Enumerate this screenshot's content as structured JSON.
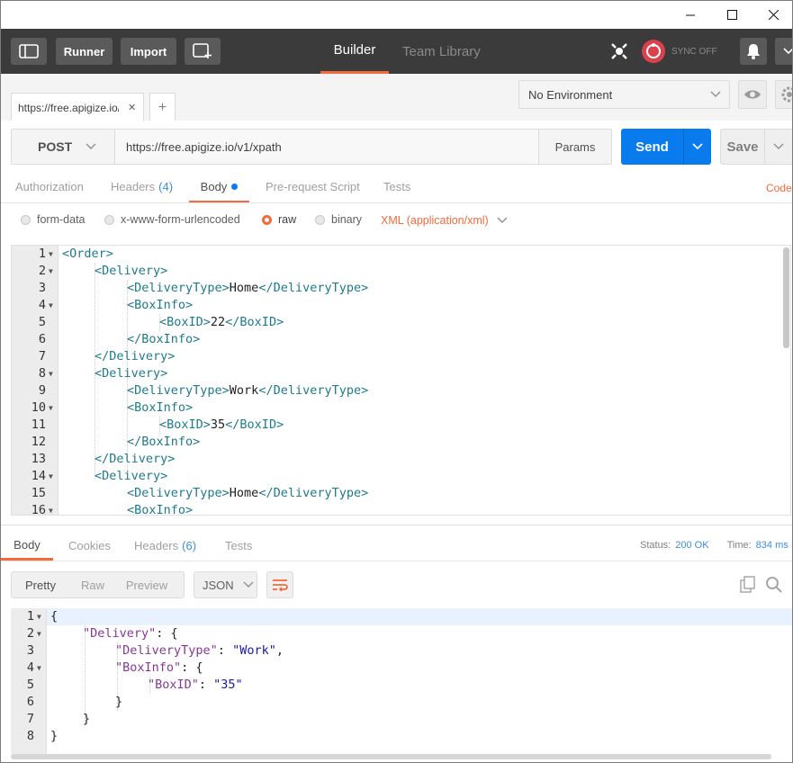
{
  "header": {
    "runner": "Runner",
    "import": "Import",
    "builder": "Builder",
    "team_library": "Team Library",
    "sync": "SYNC OFF"
  },
  "request_tab": {
    "label": "https://free.apigize.io/",
    "close": "✕",
    "add": "+"
  },
  "environment": {
    "label": "No Environment"
  },
  "request": {
    "method": "POST",
    "url": "https://free.apigize.io/v1/xpath",
    "params": "Params",
    "send": "Send",
    "save": "Save"
  },
  "request_tabs": {
    "authorization": "Authorization",
    "headers": "Headers",
    "headers_count": "(4)",
    "body": "Body",
    "prerequest": "Pre-request Script",
    "tests": "Tests",
    "code": "Code"
  },
  "body_modes": {
    "form_data": "form-data",
    "urlencoded": "x-www-form-urlencoded",
    "raw": "raw",
    "binary": "binary",
    "content_type": "XML (application/xml)"
  },
  "request_body_lines": [
    {
      "n": "1",
      "fold": true,
      "ind": 0,
      "parts": [
        [
          "tag",
          "<Order>"
        ]
      ]
    },
    {
      "n": "2",
      "fold": true,
      "ind": 1,
      "parts": [
        [
          "tag",
          "<Delivery>"
        ]
      ]
    },
    {
      "n": "3",
      "fold": false,
      "ind": 2,
      "parts": [
        [
          "tag",
          "<DeliveryType>"
        ],
        [
          "txt",
          "Home"
        ],
        [
          "tag",
          "</DeliveryType>"
        ]
      ]
    },
    {
      "n": "4",
      "fold": true,
      "ind": 2,
      "parts": [
        [
          "tag",
          "<BoxInfo>"
        ]
      ]
    },
    {
      "n": "5",
      "fold": false,
      "ind": 3,
      "parts": [
        [
          "tag",
          "<BoxID>"
        ],
        [
          "txt",
          "22"
        ],
        [
          "tag",
          "</BoxID>"
        ]
      ]
    },
    {
      "n": "6",
      "fold": false,
      "ind": 2,
      "parts": [
        [
          "tag",
          "</BoxInfo>"
        ]
      ]
    },
    {
      "n": "7",
      "fold": false,
      "ind": 1,
      "parts": [
        [
          "tag",
          "</Delivery>"
        ]
      ]
    },
    {
      "n": "8",
      "fold": true,
      "ind": 1,
      "parts": [
        [
          "tag",
          "<Delivery>"
        ]
      ]
    },
    {
      "n": "9",
      "fold": false,
      "ind": 2,
      "parts": [
        [
          "tag",
          "<DeliveryType>"
        ],
        [
          "txt",
          "Work"
        ],
        [
          "tag",
          "</DeliveryType>"
        ]
      ]
    },
    {
      "n": "10",
      "fold": true,
      "ind": 2,
      "parts": [
        [
          "tag",
          "<BoxInfo>"
        ]
      ]
    },
    {
      "n": "11",
      "fold": false,
      "ind": 3,
      "parts": [
        [
          "tag",
          "<BoxID>"
        ],
        [
          "txt",
          "35"
        ],
        [
          "tag",
          "</BoxID>"
        ]
      ]
    },
    {
      "n": "12",
      "fold": false,
      "ind": 2,
      "parts": [
        [
          "tag",
          "</BoxInfo>"
        ]
      ]
    },
    {
      "n": "13",
      "fold": false,
      "ind": 1,
      "parts": [
        [
          "tag",
          "</Delivery>"
        ]
      ]
    },
    {
      "n": "14",
      "fold": true,
      "ind": 1,
      "parts": [
        [
          "tag",
          "<Delivery>"
        ]
      ]
    },
    {
      "n": "15",
      "fold": false,
      "ind": 2,
      "parts": [
        [
          "tag",
          "<DeliveryType>"
        ],
        [
          "txt",
          "Home"
        ],
        [
          "tag",
          "</DeliveryType>"
        ]
      ]
    },
    {
      "n": "16",
      "fold": true,
      "ind": 2,
      "parts": [
        [
          "tag",
          "<BoxInfo>"
        ]
      ]
    }
  ],
  "response_tabs": {
    "body": "Body",
    "cookies": "Cookies",
    "headers": "Headers",
    "headers_count": "(6)",
    "tests": "Tests",
    "status_label": "Status:",
    "status_value": "200 OK",
    "time_label": "Time:",
    "time_value": "834 ms"
  },
  "response_view": {
    "pretty": "Pretty",
    "raw": "Raw",
    "preview": "Preview",
    "format": "JSON"
  },
  "response_body_lines": [
    {
      "n": "1",
      "fold": true,
      "ind": 0,
      "parts": [
        [
          "txt",
          "{"
        ]
      ]
    },
    {
      "n": "2",
      "fold": true,
      "ind": 1,
      "parts": [
        [
          "key",
          "\"Delivery\""
        ],
        [
          "txt",
          ": {"
        ]
      ]
    },
    {
      "n": "3",
      "fold": false,
      "ind": 2,
      "parts": [
        [
          "key",
          "\"DeliveryType\""
        ],
        [
          "txt",
          ": "
        ],
        [
          "str",
          "\"Work\""
        ],
        [
          "txt",
          ","
        ]
      ]
    },
    {
      "n": "4",
      "fold": true,
      "ind": 2,
      "parts": [
        [
          "key",
          "\"BoxInfo\""
        ],
        [
          "txt",
          ": {"
        ]
      ]
    },
    {
      "n": "5",
      "fold": false,
      "ind": 3,
      "parts": [
        [
          "key",
          "\"BoxID\""
        ],
        [
          "txt",
          ": "
        ],
        [
          "str",
          "\"35\""
        ]
      ]
    },
    {
      "n": "6",
      "fold": false,
      "ind": 2,
      "parts": [
        [
          "txt",
          "}"
        ]
      ]
    },
    {
      "n": "7",
      "fold": false,
      "ind": 1,
      "parts": [
        [
          "txt",
          "}"
        ]
      ]
    },
    {
      "n": "8",
      "fold": false,
      "ind": 0,
      "parts": [
        [
          "txt",
          "}"
        ]
      ]
    }
  ],
  "colors": {
    "accent": "#f26b3a",
    "send": "#097bed",
    "header_bg": "#3b3b3b",
    "tag": "#1f7a8c"
  }
}
